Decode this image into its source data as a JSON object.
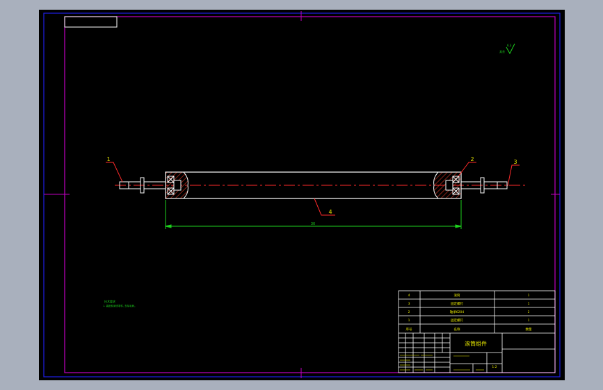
{
  "colors": {
    "background": "#a9b0bd",
    "canvas": "#000000",
    "border_blue": "#1e1ee6",
    "frame_magenta": "#c000c0",
    "line_white": "#ffffff",
    "leader_red": "#ff2a2a",
    "dimension_green": "#1ed21e",
    "text_yellow": "#e6e600",
    "hatch_red": "#c03020"
  },
  "drawing": {
    "part_labels": [
      "1",
      "2",
      "3",
      "4"
    ],
    "dimension_text": "30",
    "surface_mark": "6.3",
    "surface_mark_prefix": "其余",
    "tech_title": "技术要求",
    "tech_line": "1. 装配前清洗零件, 去除毛刺。"
  },
  "title_block": {
    "bom_rows": [
      {
        "no": "4",
        "name": "滚筒",
        "qty": "1"
      },
      {
        "no": "3",
        "name": "固定螺钉",
        "qty": "1"
      },
      {
        "no": "2",
        "name": "轴承6204",
        "qty": "2"
      },
      {
        "no": "1",
        "name": "固定螺钉",
        "qty": "1"
      }
    ],
    "bom_header": {
      "no": "序号",
      "name": "名称",
      "qty": "数量"
    },
    "drawing_title": "滚筒组件",
    "scale": "1:2"
  }
}
